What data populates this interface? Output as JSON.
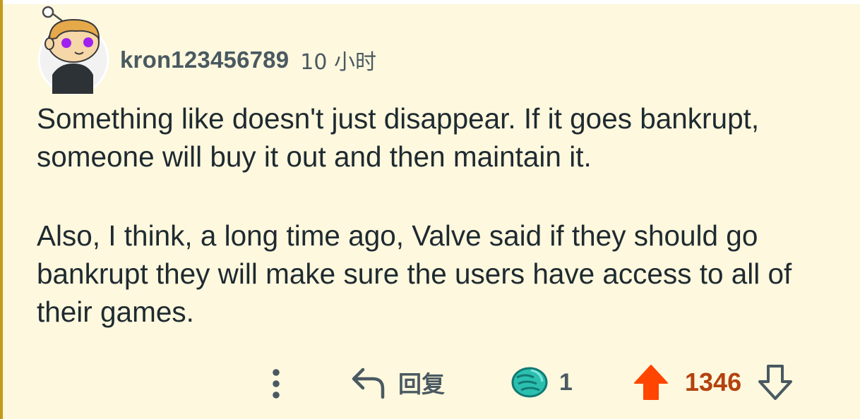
{
  "comment": {
    "author": "kron123456789",
    "timestamp": "10 小时",
    "paragraphs": [
      "Something like doesn't just disappear. If it goes bankrupt, someone will buy it out and then maintain it.",
      "Also, I think, a long time ago, Valve said if they should go bankrupt they will make sure the users have access to all of their games."
    ]
  },
  "actions": {
    "more_icon": "vertical-dots-icon",
    "reply_icon": "reply-arrow-icon",
    "reply_label": "回复",
    "award_icon": "fist-bump-award-icon",
    "award_count": "1",
    "upvote_icon": "upvote-arrow-icon",
    "score": "1346",
    "downvote_icon": "downvote-arrow-icon"
  },
  "colors": {
    "background": "#fdf8de",
    "thread_line": "#c49a1c",
    "meta_text": "#4a5961",
    "body_text": "#1f2a30",
    "upvote": "#ff4500",
    "score": "#b3420f",
    "award": "#2bbfb0"
  }
}
